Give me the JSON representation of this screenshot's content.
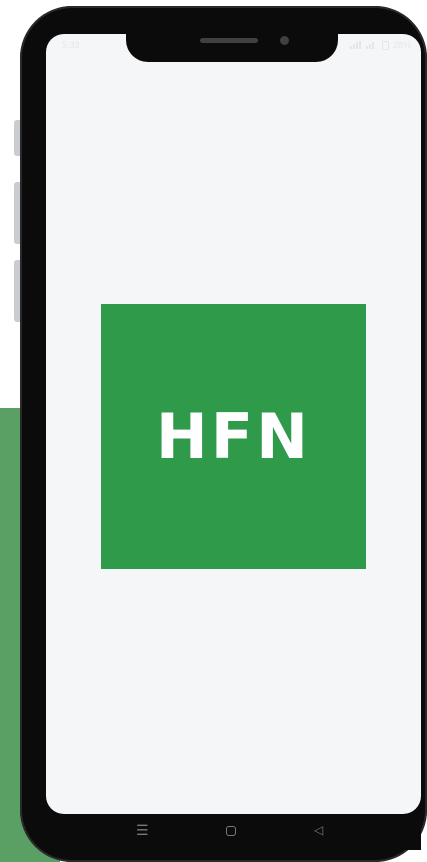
{
  "status_bar": {
    "time": "5:33",
    "battery_text": "28%"
  },
  "app": {
    "logo_text": "HFN",
    "brand_color": "#2e9a4a"
  },
  "nav_bar": {
    "menu_icon": "menu-icon",
    "home_icon": "home-icon",
    "back_icon": "back-icon"
  },
  "background": {
    "accent_color": "#5a9f64"
  }
}
